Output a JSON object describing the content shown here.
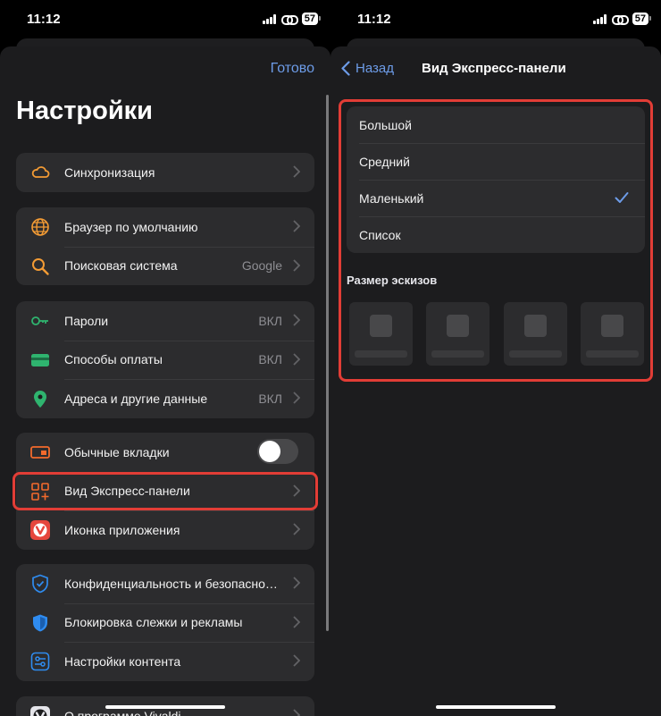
{
  "status": {
    "time": "11:12",
    "battery": "57"
  },
  "settings": {
    "done": "Готово",
    "title": "Настройки",
    "groups": [
      {
        "rows": [
          {
            "label": "Синхронизация",
            "value": "",
            "icon": "cloud-icon"
          }
        ]
      },
      {
        "rows": [
          {
            "label": "Браузер по умолчанию",
            "value": "",
            "icon": "globe-icon"
          },
          {
            "label": "Поисковая система",
            "value": "Google",
            "icon": "magnifier-icon"
          }
        ]
      },
      {
        "rows": [
          {
            "label": "Пароли",
            "value": "ВКЛ",
            "icon": "key-icon"
          },
          {
            "label": "Способы оплаты",
            "value": "ВКЛ",
            "icon": "credit-card-icon"
          },
          {
            "label": "Адреса и другие данные",
            "value": "ВКЛ",
            "icon": "location-pin-icon"
          }
        ]
      },
      {
        "rows": [
          {
            "label": "Обычные вкладки",
            "toggle": false,
            "icon": "tabs-icon"
          },
          {
            "label": "Вид Экспресс-панели",
            "value": "",
            "icon": "grid-plus-icon",
            "highlighted": true
          },
          {
            "label": "Иконка приложения",
            "value": "",
            "icon": "vivaldi-icon"
          }
        ]
      },
      {
        "rows": [
          {
            "label": "Конфиденциальность и безопасность",
            "value": "",
            "icon": "shield-check-icon"
          },
          {
            "label": "Блокировка слежки и рекламы",
            "value": "",
            "icon": "shield-icon"
          },
          {
            "label": "Настройки контента",
            "value": "",
            "icon": "sliders-icon"
          }
        ]
      },
      {
        "rows": [
          {
            "label": "О программе Vivaldi",
            "value": "",
            "icon": "vivaldi-icon"
          }
        ]
      }
    ]
  },
  "speed_dial": {
    "back": "Назад",
    "title": "Вид Экспресс-панели",
    "options": [
      "Большой",
      "Средний",
      "Маленький",
      "Список"
    ],
    "selected": "Маленький",
    "thumb_section_label": "Размер эскизов"
  },
  "colors": {
    "accent": "#6d9ce8",
    "highlight": "#e23d36",
    "orange_icon": "#f39b34",
    "green_icon": "#2fb46f",
    "blue_icon": "#2f8cf0",
    "vivaldi_red": "#e6463d"
  }
}
